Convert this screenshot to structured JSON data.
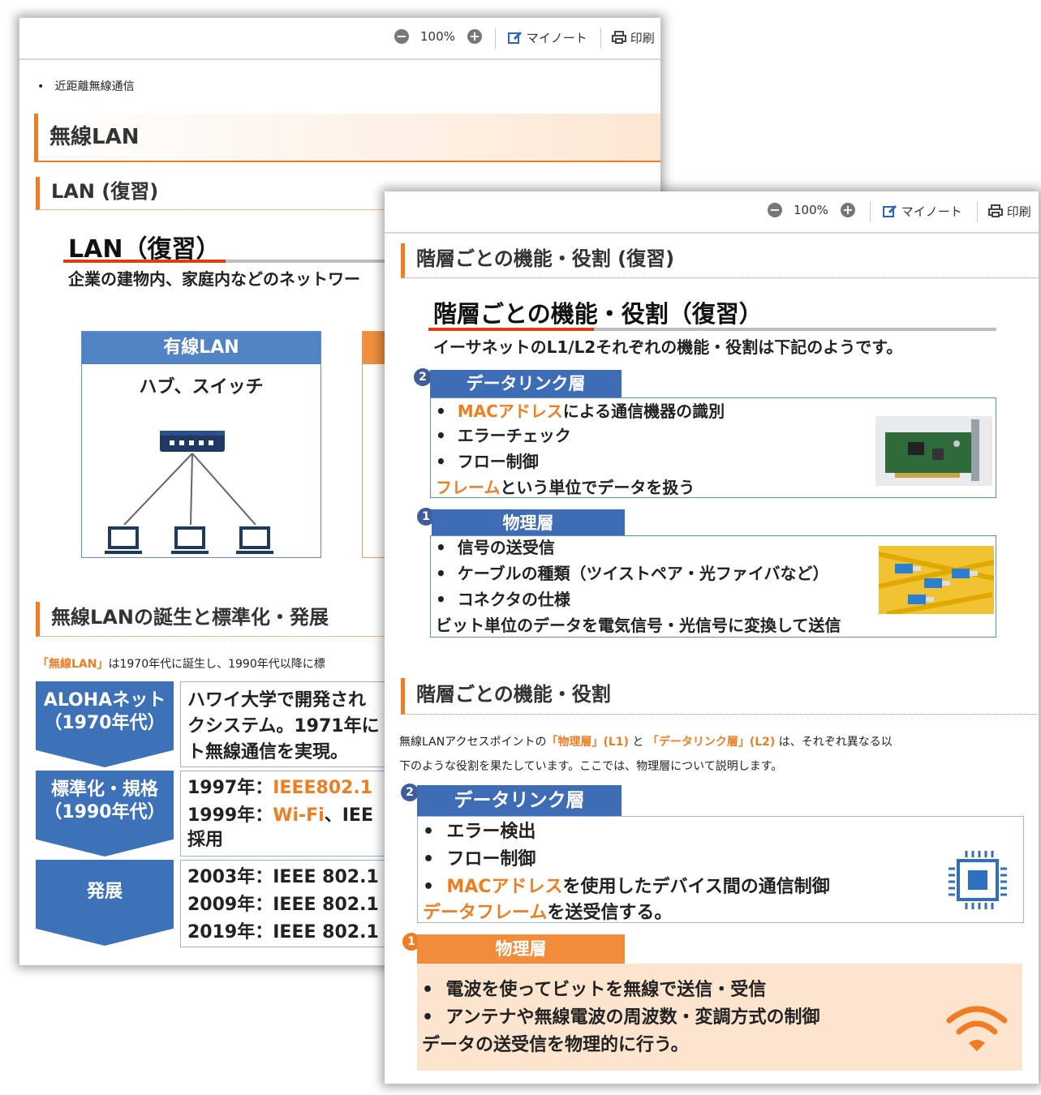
{
  "toolbar": {
    "zoom": "100%",
    "my_note": "マイノート",
    "print": "印刷",
    "zoom_out_glyph": "−",
    "zoom_in_glyph": "+"
  },
  "pageA": {
    "bullet": "近距離無線通信",
    "section_title": "無線LAN",
    "sub_title": "LAN (復習)",
    "slide_title": "LAN（復習）",
    "slide_desc": "企業の建物内、家庭内などのネットワー",
    "wired": {
      "header": "有線LAN",
      "device": "ハブ、スイッチ"
    },
    "history_title": "無線LANの誕生と標準化・発展",
    "history_intro_hl": "「無線LAN」",
    "history_intro": "は1970年代に誕生し、1990年代以降に標",
    "timeline": [
      {
        "label": "ALOHAネット（1970年代）",
        "lines": [
          {
            "text": "ハワイ大学で開発され",
            "hl": ""
          },
          {
            "text": "クシステム。1971年に",
            "hl": ""
          },
          {
            "text": "ト無線通信を実現。",
            "hl": ""
          }
        ]
      },
      {
        "label": "標準化・規格（1990年代）",
        "lines": [
          {
            "text": "1997年：",
            "hl": "IEEE802.1"
          },
          {
            "text": "1999年：",
            "hl": "Wi-Fi",
            "tail": "、IEE"
          },
          {
            "text": "採用",
            "hl": ""
          }
        ]
      },
      {
        "label": "発展",
        "lines": [
          {
            "text": "2003年：IEEE 802.1",
            "hl": ""
          },
          {
            "text": "2009年：IEEE 802.1",
            "hl": ""
          },
          {
            "text": "2019年：IEEE 802.1",
            "hl": ""
          }
        ]
      }
    ]
  },
  "pageB": {
    "sub_title_1": "階層ごとの機能・役割 (復習)",
    "slide_title": "階層ごとの機能・役割（復習）",
    "slide_desc": "イーサネットのL1/L2それぞれの機能・役割は下記のようです。",
    "dl_review": {
      "num": "2",
      "header": "データリンク層",
      "item1_hl": "MACアドレス",
      "item1_rest": "による通信機器の識別",
      "item2": "エラーチェック",
      "item3": "フロー制御",
      "footer_hl": "フレーム",
      "footer_rest": "という単位でデータを扱う"
    },
    "ph_review": {
      "num": "1",
      "header": "物理層",
      "item1": "信号の送受信",
      "item2": "ケーブルの種類（ツイストペア・光ファイバなど）",
      "item3": "コネクタの仕様",
      "footer": "ビット単位のデータを電気信号・光信号に変換して送信"
    },
    "sub_title_2": "階層ごとの機能・役割",
    "para_a": "無線LANアクセスポイントの",
    "para_hl1": "「物理層」(L1)",
    "para_b": "と",
    "para_hl2": "「データリンク層」(L2)",
    "para_c": "は、それぞれ異なる以",
    "para_line2": "下のような役割を果たしています。ここでは、物理層について説明します。",
    "dl": {
      "num": "2",
      "header": "データリンク層",
      "item1": "エラー検出",
      "item2": "フロー制御",
      "item3_hl": "MACアドレス",
      "item3_rest": "を使用したデバイス間の通信制御",
      "footer_hl": "データフレーム",
      "footer_rest": "を送受信する。"
    },
    "ph": {
      "num": "1",
      "header": "物理層",
      "item1": "電波を使ってビットを無線で送信・受信",
      "item2": "アンテナや無線電波の周波数・変調方式の制御",
      "footer": "データの送受信を物理的に行う。"
    }
  },
  "colors": {
    "accent": "#ef7d22",
    "blue": "#3e6db5",
    "red_underline": "#e23a12",
    "peach": "#fde4cf"
  },
  "icons": [
    "zoom-out-icon",
    "zoom-in-icon",
    "note-edit-icon",
    "printer-icon",
    "switch-hub-icon",
    "laptop-icon",
    "nic-card-photo",
    "fiber-cable-photo",
    "chip-icon",
    "wifi-icon"
  ]
}
